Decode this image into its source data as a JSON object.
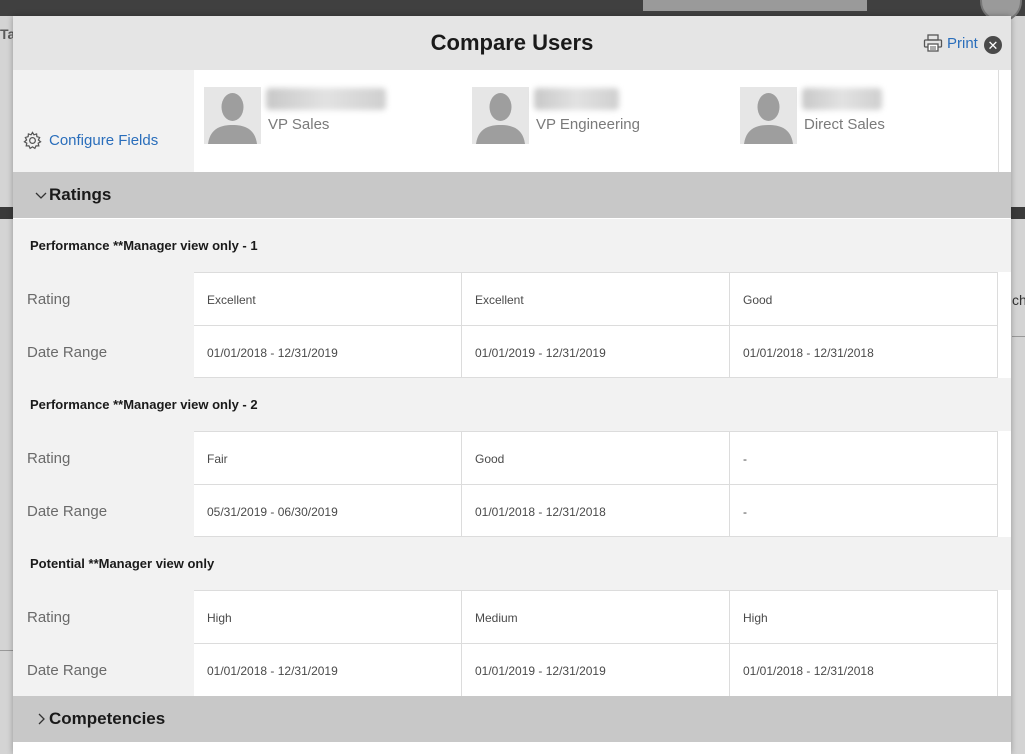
{
  "background": {
    "tab_fragment": "Ta",
    "right_fragment": "ch"
  },
  "modal": {
    "title": "Compare Users",
    "print_label": "Print",
    "close_glyph": "✕",
    "configure_label": "Configure Fields"
  },
  "users": [
    {
      "role": "VP Sales"
    },
    {
      "role": "VP Engineering"
    },
    {
      "role": "Direct Sales"
    }
  ],
  "sections": {
    "ratings": {
      "title": "Ratings",
      "groups": [
        {
          "title": "Performance **Manager view only - 1",
          "rows": [
            {
              "label": "Rating",
              "values": [
                "Excellent",
                "Excellent",
                "Good"
              ]
            },
            {
              "label": "Date Range",
              "values": [
                "01/01/2018 - 12/31/2019",
                "01/01/2019 - 12/31/2019",
                "01/01/2018 - 12/31/2018"
              ]
            }
          ]
        },
        {
          "title": "Performance **Manager view only - 2",
          "rows": [
            {
              "label": "Rating",
              "values": [
                "Fair",
                "Good",
                "-"
              ]
            },
            {
              "label": "Date Range",
              "values": [
                "05/31/2019 - 06/30/2019",
                "01/01/2018 - 12/31/2018",
                "-"
              ]
            }
          ]
        },
        {
          "title": "Potential **Manager view only",
          "rows": [
            {
              "label": "Rating",
              "values": [
                "High",
                "Medium",
                "High"
              ]
            },
            {
              "label": "Date Range",
              "values": [
                "01/01/2018 - 12/31/2019",
                "01/01/2019 - 12/31/2019",
                "01/01/2018 - 12/31/2018"
              ]
            }
          ]
        }
      ]
    },
    "competencies": {
      "title": "Competencies"
    }
  },
  "colors": {
    "link": "#2a6ebb",
    "section_bg": "#c8c8c8",
    "group_bg": "#f2f2f2"
  }
}
